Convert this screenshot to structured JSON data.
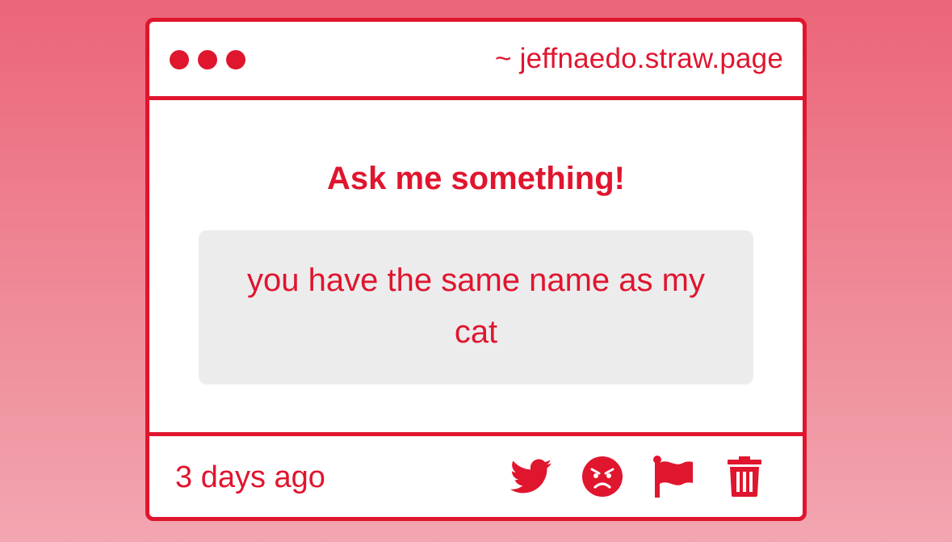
{
  "window": {
    "url": "~ jeffnaedo.straw.page"
  },
  "main": {
    "title": "Ask me something!",
    "message": "you have the same name as my cat"
  },
  "footer": {
    "timestamp": "3 days ago",
    "actions": [
      "twitter-icon",
      "angry-face-icon",
      "flag-icon",
      "trash-icon"
    ]
  },
  "colors": {
    "accent": "#e0152e",
    "message_background": "#ececed",
    "page_background_top": "#eb6578",
    "page_background_bottom": "#f2a6b1"
  }
}
